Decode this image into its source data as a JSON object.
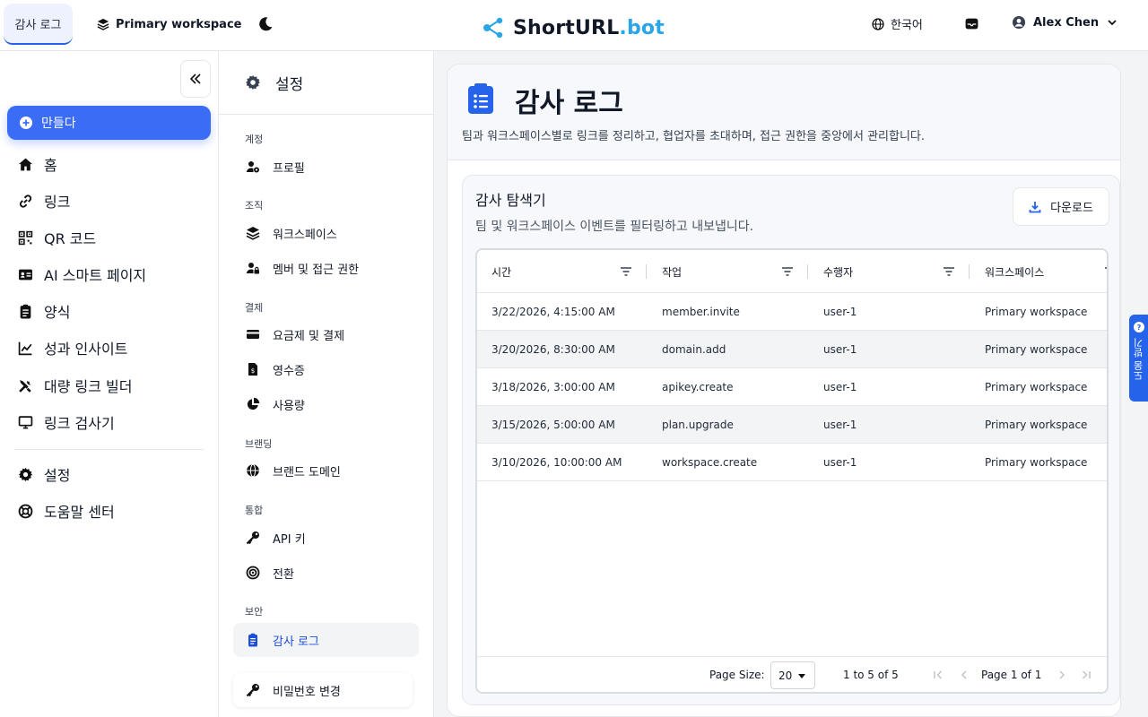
{
  "topbar": {
    "active_tab": "감사 로그",
    "workspace": "Primary workspace",
    "logo_short": "ShortURL",
    "logo_bot": ".bot",
    "language": "한국어",
    "user_name": "Alex Chen"
  },
  "leftnav": {
    "create_label": "만들다",
    "items": [
      {
        "label": "홈",
        "icon": "home-icon"
      },
      {
        "label": "링크",
        "icon": "link-icon"
      },
      {
        "label": "QR 코드",
        "icon": "qr-code-icon"
      },
      {
        "label": "AI 스마트 페이지",
        "icon": "id-card-icon"
      },
      {
        "label": "양식",
        "icon": "clipboard-icon"
      },
      {
        "label": "성과 인사이트",
        "icon": "chart-line-icon"
      },
      {
        "label": "대량 링크 빌더",
        "icon": "tools-icon"
      },
      {
        "label": "링크 검사기",
        "icon": "monitor-icon"
      },
      {
        "label": "설정",
        "icon": "gear-icon"
      },
      {
        "label": "도움말 센터",
        "icon": "lifebuoy-icon"
      }
    ]
  },
  "settings_nav": {
    "title": "설정",
    "sections": [
      {
        "label": "계정",
        "items": [
          {
            "label": "프로필"
          }
        ]
      },
      {
        "label": "조직",
        "items": [
          {
            "label": "워크스페이스"
          },
          {
            "label": "멤버 및 접근 권한"
          }
        ]
      },
      {
        "label": "결제",
        "items": [
          {
            "label": "요금제 및 결제"
          },
          {
            "label": "영수증"
          },
          {
            "label": "사용량"
          }
        ]
      },
      {
        "label": "브랜딩",
        "items": [
          {
            "label": "브랜드 도메인"
          }
        ]
      },
      {
        "label": "통합",
        "items": [
          {
            "label": "API 키"
          },
          {
            "label": "전환"
          }
        ]
      },
      {
        "label": "보안",
        "items": [
          {
            "label": "감사 로그"
          },
          {
            "label": "비밀번호 변경"
          }
        ]
      }
    ]
  },
  "main": {
    "title": "감사 로그",
    "description": "팀과 워크스페이스별로 링크를 정리하고, 협업자를 초대하며, 접근 권한을 중앙에서 관리합니다.",
    "explorer_title": "감사 탐색기",
    "explorer_subtitle": "팀 및 워크스페이스 이벤트를 필터링하고 내보냅니다.",
    "download_label": "다운로드",
    "columns": [
      "시간",
      "작업",
      "수행자",
      "워크스페이스"
    ],
    "rows": [
      [
        "3/22/2026, 4:15:00 AM",
        "member.invite",
        "user-1",
        "Primary workspace"
      ],
      [
        "3/20/2026, 8:30:00 AM",
        "domain.add",
        "user-1",
        "Primary workspace"
      ],
      [
        "3/18/2026, 3:00:00 AM",
        "apikey.create",
        "user-1",
        "Primary workspace"
      ],
      [
        "3/15/2026, 5:00:00 AM",
        "plan.upgrade",
        "user-1",
        "Primary workspace"
      ],
      [
        "3/10/2026, 10:00:00 AM",
        "workspace.create",
        "user-1",
        "Primary workspace"
      ]
    ],
    "pager": {
      "page_size_label": "Page Size:",
      "page_size": "20",
      "range": "1 to 5 of 5",
      "page": "Page 1 of 1"
    }
  },
  "help_tab": "도움 받기",
  "colors": {
    "accent": "#3b6cf6",
    "logo_accent": "#2aa6e8"
  }
}
